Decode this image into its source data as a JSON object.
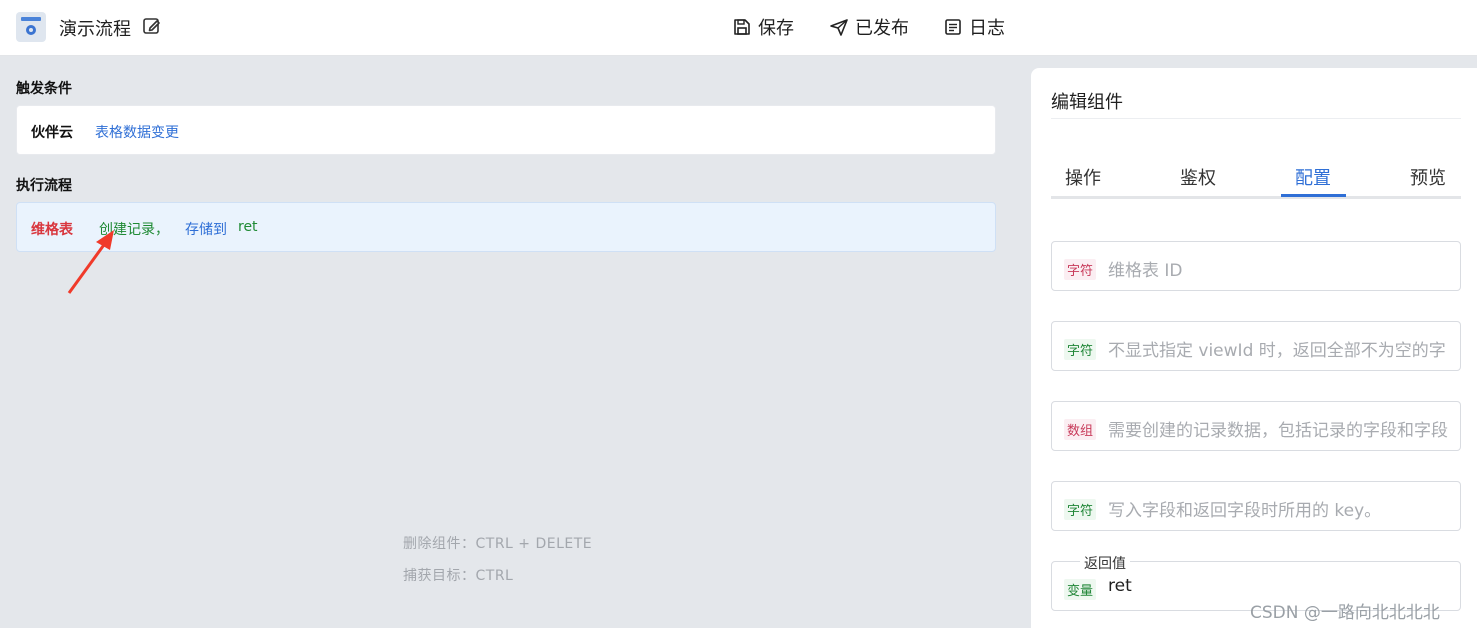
{
  "header": {
    "title": "演示流程",
    "save_label": "保存",
    "publish_label": "已发布",
    "log_label": "日志"
  },
  "trigger": {
    "label": "触发条件",
    "source": "伙伴云",
    "event": "表格数据变更"
  },
  "flow": {
    "label": "执行流程",
    "app": "维格表",
    "action": "创建记录，",
    "store_prefix": "存储到",
    "store_var": "ret"
  },
  "hints": {
    "delete": "删除组件：CTRL + DELETE",
    "capture": "捕获目标：CTRL"
  },
  "panel": {
    "title": "编辑组件",
    "tabs": [
      "操作",
      "鉴权",
      "配置",
      "预览"
    ],
    "active_tab": "配置",
    "fields": [
      {
        "type_tag": "字符",
        "placeholder": "维格表 ID"
      },
      {
        "type_tag": "字符",
        "placeholder": "不显式指定 viewId 时，返回全部不为空的字"
      },
      {
        "type_tag": "数组",
        "placeholder": "需要创建的记录数据，包括记录的字段和字段"
      },
      {
        "type_tag": "字符",
        "placeholder": "写入字段和返回字段时所用的 key。"
      }
    ],
    "return": {
      "legend": "返回值",
      "type_tag": "变量",
      "value": "ret"
    }
  },
  "watermark": "CSDN @一路向北北北北",
  "colors": {
    "accent": "#2f6fd6",
    "app_red": "#d9363e",
    "action_green": "#1f8a34"
  }
}
